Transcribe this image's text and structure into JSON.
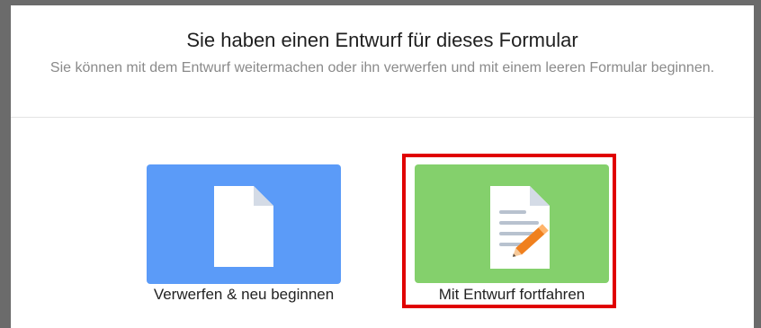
{
  "dialog": {
    "title": "Sie haben einen Entwurf für dieses Formular",
    "subtitle": "Sie können mit dem Entwurf weitermachen oder ihn verwerfen und mit einem leeren Formular beginnen."
  },
  "options": [
    {
      "label": "Verwerfen & neu beginnen",
      "icon": "blank-document-icon",
      "color": "#5b9bf8"
    },
    {
      "label": "Mit Entwurf fortfahren",
      "icon": "edit-document-icon",
      "color": "#84d06c",
      "highlighted": true
    }
  ],
  "colors": {
    "highlight": "#e00000",
    "frame": "#6b6b6b"
  }
}
